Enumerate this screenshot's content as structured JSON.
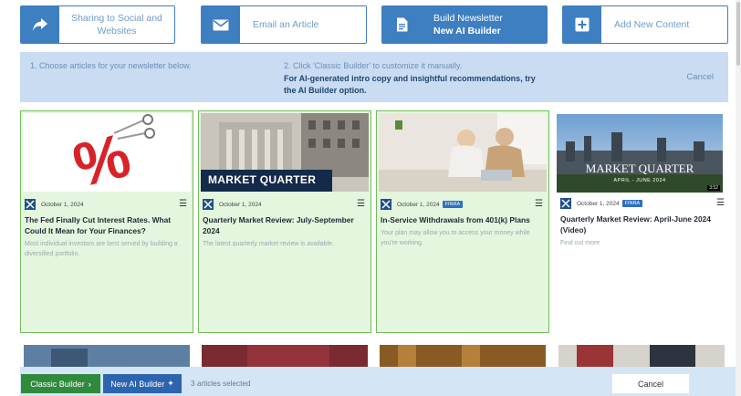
{
  "actions": [
    {
      "label": "Sharing to Social and Websites",
      "icon": "share-arrow-icon"
    },
    {
      "label": "Email an Article",
      "icon": "envelope-icon"
    },
    {
      "label_line1": "Build Newsletter",
      "label_line2": "New AI Builder",
      "icon": "document-icon"
    },
    {
      "label": "Add New Content",
      "icon": "plus-square-icon"
    }
  ],
  "banner": {
    "step1": "1. Choose articles for your newsletter below.",
    "step2": "2. Click 'Classic Builder' to customize it manually.",
    "ai_line": "For AI-generated intro copy and insightful recommendations, try the AI Builder option.",
    "cancel": "Cancel"
  },
  "cards": [
    {
      "date": "October 1, 2024",
      "tag": "",
      "title": "The Fed Finally Cut Interest Rates. What Could It Mean for Your Finances?",
      "desc": "Most individual investors are best served by building a diversified portfolio.",
      "selected": true
    },
    {
      "date": "October 1, 2024",
      "tag": "",
      "title": "Quarterly Market Review: July-September 2024",
      "desc": "The latest quarterly market review is available.",
      "thumb_text": "MARKET QUARTER",
      "selected": true
    },
    {
      "date": "October 1, 2024",
      "tag": "FINRA",
      "title": "In-Service Withdrawals from 401(k) Plans",
      "desc": "Your plan may allow you to access your money while you're working.",
      "selected": true
    },
    {
      "date": "October 1, 2024",
      "tag": "FINRA",
      "title": "Quarterly Market Review: April-June 2024 (Video)",
      "desc": "Find out more",
      "thumb_text": "MARKET QUARTER",
      "thumb_sub": "APRIL - JUNE 2024",
      "thumb_time": "3:52",
      "selected": false
    }
  ],
  "bottom": {
    "classic": "Classic Builder",
    "ai": "New AI Builder",
    "count": "3 articles selected",
    "cancel": "Cancel"
  },
  "colors": {
    "accent": "#3e7fc2",
    "selected_bg": "#e4f6dd",
    "selected_border": "#72bd5e",
    "classic_btn": "#2f8a3d",
    "ai_btn": "#2c64b0"
  }
}
